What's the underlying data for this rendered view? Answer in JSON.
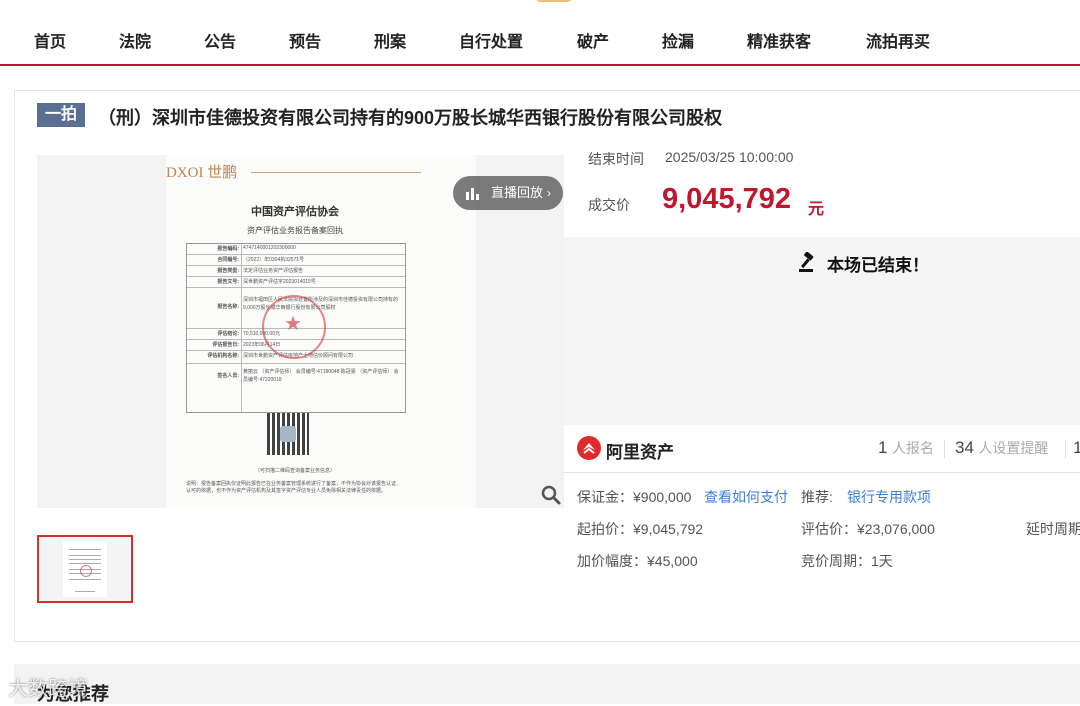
{
  "nav": {
    "items": [
      "首页",
      "法院",
      "公告",
      "预告",
      "刑案",
      "自行处置",
      "破产",
      "捡漏",
      "精准获客",
      "流拍再买"
    ]
  },
  "listing": {
    "badge": "一拍",
    "title": "（刑）深圳市佳德投资有限公司持有的900万股长城华西银行股份有限公司股权"
  },
  "gallery": {
    "replay_label": "直播回放",
    "replay_chevron": "›",
    "document": {
      "logo": "DΧOI 世鹏",
      "heading": "中国资产评估协会",
      "subheading": "资产评估业务报告备案回执",
      "rows": [
        {
          "label": "报告编码:",
          "value": "4747140001202300000"
        },
        {
          "label": "合同编号:",
          "value": "（2022）年0304执32571号"
        },
        {
          "label": "报告类型:",
          "value": "法定评估业务资产评估报告"
        },
        {
          "label": "报告文号:",
          "value": "深世鹏资产评估字2023014015号"
        },
        {
          "label": "报告名称:",
          "value": "深圳市福田区人民法院拟处置所涉及的深圳市佳德投资有限公司持有的9,000万股长城华西银行股份有限公司股权"
        },
        {
          "label": "评估结论:",
          "value": "70,510,000.00元"
        },
        {
          "label": "评估报告日:",
          "value": "2023年06月14日"
        },
        {
          "label": "评估机构名称:",
          "value": "深圳市世鹏资产评估房地产土地估价顾问有限公司"
        },
        {
          "label": "签名人员:",
          "value": "黄丽云 （资产评估师） 会员编号:47180048  陈冠豪 （资产评估师） 会员编号:47220018"
        }
      ],
      "caption": "（可扫描二维码查询备案业务信息）",
      "note": "说明：报告备案回执仅证明此报告已在业务备案管理系统进行了备案，不作为协会对该报告认证、认可的依据，也不作为资产评估机构及其签字资产评估专业人员免除相关法律责任的依据。"
    }
  },
  "auction": {
    "end_label": "结束时间",
    "end_time": "2025/03/25 10:00:00",
    "deal_label": "成交价",
    "deal_price": "9,045,792",
    "deal_unit": "元",
    "ended_message": "本场已结束！"
  },
  "platform": {
    "name": "阿里资产",
    "stats": [
      {
        "value": "1",
        "label": "人报名"
      },
      {
        "value": "34",
        "label": "人设置提醒"
      },
      {
        "value": "1",
        "label": ""
      }
    ]
  },
  "details": {
    "deposit": "保证金：¥900,000",
    "how_to_pay": "查看如何支付",
    "recommend_label": "推荐:",
    "bank_loan": "银行专用款项",
    "start_price": "起拍价：¥9,045,792",
    "appraisal": "评估价：¥23,076,000",
    "delay_period": "延时周期",
    "increment": "加价幅度：¥45,000",
    "bidding_period": "竞价周期：1天"
  },
  "recommend": {
    "title": "为您推荐"
  },
  "watermark": "大数跨境",
  "colors": {
    "accent": "#c0172d",
    "badge": "#5a6f91",
    "link": "#3b7dd8"
  }
}
